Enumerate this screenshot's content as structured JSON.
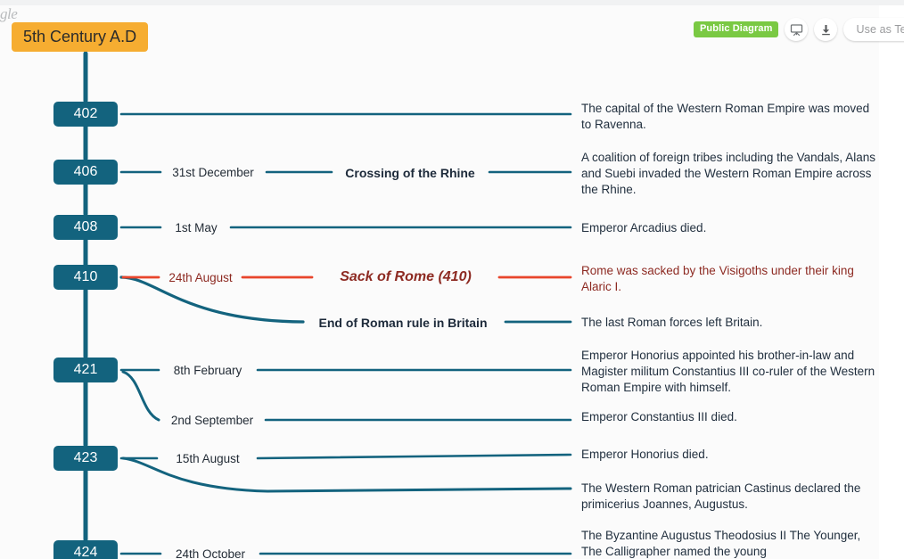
{
  "app": {
    "watermark": "gle"
  },
  "toolbar": {
    "public_badge": "Public Diagram",
    "present_icon": "presentation-screen-icon",
    "download_icon": "download-arrow-icon",
    "template_button": "Use as Tem"
  },
  "diagram": {
    "title": "5th Century A.D",
    "title_color": "#f6ad31",
    "accent_color": "#13637e",
    "highlight_color": "#e8452c",
    "highlight_text_color": "#8d2a22",
    "rows": [
      {
        "year": "402",
        "date": "",
        "event": "",
        "description": "The capital of the Western Roman Empire was moved to Ravenna."
      },
      {
        "year": "406",
        "date": "31st December",
        "event": "Crossing of the Rhine",
        "description": "A coalition of foreign tribes including the Vandals, Alans and Suebi invaded the Western Roman Empire across the Rhine."
      },
      {
        "year": "408",
        "date": "1st May",
        "event": "",
        "description": "Emperor Arcadius died."
      },
      {
        "year": "410",
        "date": "24th August",
        "event": "Sack of Rome (410)",
        "description": "Rome was sacked by the Visigoths under their king Alaric I.",
        "highlighted": true
      },
      {
        "year": "",
        "date": "",
        "event": "End of Roman rule in Britain",
        "description": "The last Roman forces left Britain."
      },
      {
        "year": "421",
        "date": "8th February",
        "event": "",
        "description": "Emperor Honorius appointed his brother-in-law and Magister militum Constantius III co-ruler of the Western Roman Empire with himself."
      },
      {
        "year": "",
        "date": "2nd September",
        "event": "",
        "description": "Emperor Constantius III died."
      },
      {
        "year": "423",
        "date": "15th August",
        "event": "",
        "description": "Emperor Honorius died."
      },
      {
        "year": "",
        "date": "",
        "event": "",
        "description": "The Western Roman patrician Castinus declared the primicerius Joannes, Augustus."
      },
      {
        "year": "424",
        "date": "24th October",
        "event": "",
        "description": "The Byzantine Augustus Theodosius II The Younger, The Calligrapher named the young"
      }
    ]
  }
}
